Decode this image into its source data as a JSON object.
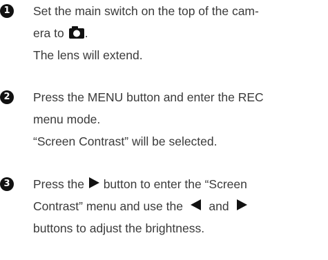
{
  "steps": [
    {
      "number": "1",
      "lines": [
        "Set the main switch on the top of the cam-",
        "era to",
        "The lens will extend."
      ],
      "icon": "camera-icon"
    },
    {
      "number": "2",
      "lines": [
        "Press the MENU button and enter the REC",
        "menu mode.",
        "“Screen Contrast” will be selected."
      ]
    },
    {
      "number": "3",
      "line1_before": "Press the",
      "line1_after": "button to enter the “Screen",
      "line2_before": "Contrast” menu and use the",
      "line2_mid": "and",
      "line3": "buttons to adjust the brightness.",
      "icons": [
        "right-triangle-icon",
        "left-triangle-icon"
      ]
    }
  ]
}
